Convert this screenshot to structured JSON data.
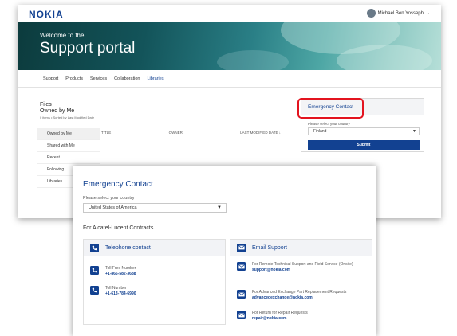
{
  "portal": {
    "logo": "NOKIA",
    "user_name": "Michael Ben Yosseph",
    "user_chevron": "⌄",
    "hero_subtitle": "Welcome to the",
    "hero_title": "Support portal",
    "nav": [
      "Support",
      "Products",
      "Services",
      "Collaboration",
      "Libraries"
    ],
    "files_label": "Files",
    "files_title": "Owned by Me",
    "files_sub": "0 items • Sorted by Last Modified Date",
    "side_items": [
      "Owned by Me",
      "Shared with Me",
      "Recent",
      "Following",
      "Libraries"
    ],
    "columns": [
      "TITLE",
      "OWNER",
      "LAST MODIFIED DATE ↓"
    ],
    "emergency_small": {
      "title": "Emergency Contact",
      "country_label": "Please select your country",
      "country_value": "Finland",
      "submit_label": "Submit"
    }
  },
  "front": {
    "title": "Emergency Contact",
    "country_label": "Please select your country",
    "country_value": "United States of America",
    "section_title": "For Alcatel-Lucent Contracts",
    "telephone": {
      "title": "Telephone contact",
      "items": [
        {
          "label": "Toll Free Number",
          "value": "+1-866-582-3688"
        },
        {
          "label": "Toll Number",
          "value": "+1-613-784-6990"
        }
      ]
    },
    "email": {
      "title": "Email Support",
      "items": [
        {
          "label": "For Remote Technical Support and Field Service (Onsite)",
          "value": "support@nokia.com"
        },
        {
          "label": "For Advanced Exchange Part Replacement Requests",
          "value": "advancedexchange@nokia.com"
        },
        {
          "label": "For Return for Repair Requests",
          "value": "repair@nokia.com"
        }
      ]
    }
  },
  "colors": {
    "brand": "#124191",
    "highlight": "#e3141f"
  },
  "icons": [
    "phone-icon",
    "email-icon",
    "user-avatar-icon",
    "chevron-down-icon"
  ]
}
